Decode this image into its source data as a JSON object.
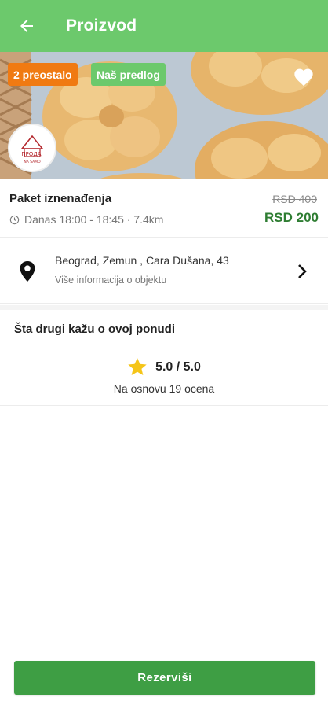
{
  "appbar": {
    "title": "Proizvod",
    "back_icon": "arrow-left-icon",
    "color": "#6cc96c"
  },
  "hero": {
    "badge_left": "2 preostalo",
    "badge_right": "Naš predlog",
    "badge_left_color": "#f07a12",
    "badge_right_color": "#6cc96c",
    "favorite_icon": "heart-icon",
    "logo_text": "ПРОДАЈ",
    "logo_subtext": "NA SAMO"
  },
  "product": {
    "name": "Paket iznenađenja",
    "time_distance": "Danas 18:00 - 18:45 · 7.4km",
    "old_price": "RSD 400",
    "new_price": "RSD 200",
    "price_color": "#2e7d32"
  },
  "location": {
    "address": "Beograd, Zemun , Cara Dušana, 43",
    "more_info": "Više informacija o objektu",
    "pin_icon": "location-pin-icon",
    "chevron_icon": "chevron-right-icon"
  },
  "reviews": {
    "title": "Šta drugi kažu o ovoj ponudi",
    "rating": "5.0 / 5.0",
    "based_on": "Na osnovu 19 ocena",
    "star_icon": "star-icon",
    "star_color": "#f5c518"
  },
  "actions": {
    "reserve_label": "Rezerviši",
    "reserve_color": "#3e9e44"
  }
}
